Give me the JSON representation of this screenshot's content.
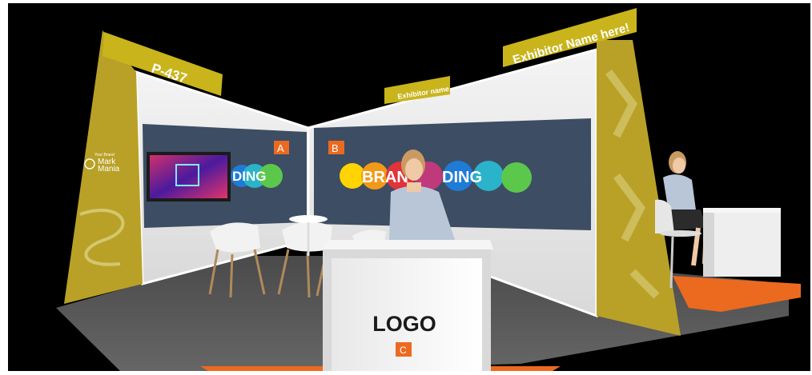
{
  "booth": {
    "stand_number": "P-437",
    "exhibitor_header": "Exhibitor Name here!",
    "center_header": "Exhibitor name",
    "panel_a_marker": "A",
    "panel_b_marker": "B",
    "counter_marker": "C",
    "counter_logo": "LOGO",
    "branding_left": "DING",
    "branding_right_1": "BRAN",
    "branding_right_2": "DING",
    "column_brand_line1": "Your Brand",
    "column_brand_line2": "Mark",
    "column_brand_line3": "Mania"
  },
  "colors": {
    "frame_gold": "#b9a127",
    "header_yellow": "#c9b41c",
    "marker_orange": "#ec6a1f",
    "panel_navy": "#3d4d63",
    "floor_orange": "#ec6a1f",
    "floor_grey": "#555555"
  }
}
